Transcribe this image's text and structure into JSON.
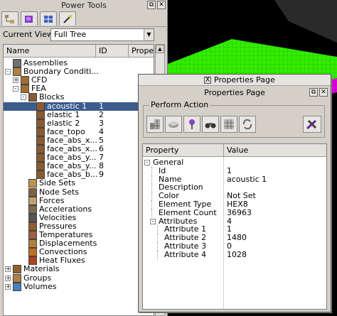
{
  "power_tools": {
    "title": "Power Tools",
    "current_view_label": "Current View",
    "current_view_value": "Full Tree",
    "columns": [
      "Name",
      "ID",
      "Proper"
    ],
    "tree": [
      {
        "label": "Assemblies",
        "id": "",
        "icon": "assemblies-icon",
        "depth": 0,
        "exp": ""
      },
      {
        "label": "Boundary Conditi...",
        "id": "",
        "icon": "boundary-conditions-icon",
        "depth": 0,
        "exp": "-"
      },
      {
        "label": "CFD",
        "id": "",
        "icon": "cfd-icon",
        "depth": 1,
        "exp": "+"
      },
      {
        "label": "FEA",
        "id": "",
        "icon": "fea-icon",
        "depth": 1,
        "exp": "-"
      },
      {
        "label": "Blocks",
        "id": "",
        "icon": "blocks-icon",
        "depth": 2,
        "exp": "-"
      },
      {
        "label": "acoustic 1",
        "id": "1",
        "icon": "block-icon",
        "depth": 3,
        "exp": "",
        "selected": true
      },
      {
        "label": "elastic 1",
        "id": "2",
        "icon": "block-icon",
        "depth": 3,
        "exp": ""
      },
      {
        "label": "elastic 2",
        "id": "3",
        "icon": "block-icon",
        "depth": 3,
        "exp": ""
      },
      {
        "label": "face_topo",
        "id": "4",
        "icon": "block-icon",
        "depth": 3,
        "exp": ""
      },
      {
        "label": "face_abs_x...",
        "id": "5",
        "icon": "block-icon",
        "depth": 3,
        "exp": ""
      },
      {
        "label": "face_abs_x...",
        "id": "6",
        "icon": "block-icon",
        "depth": 3,
        "exp": ""
      },
      {
        "label": "face_abs_y...",
        "id": "7",
        "icon": "block-icon",
        "depth": 3,
        "exp": ""
      },
      {
        "label": "face_abs_y...",
        "id": "8",
        "icon": "block-icon",
        "depth": 3,
        "exp": ""
      },
      {
        "label": "face_abs_b...",
        "id": "9",
        "icon": "block-icon",
        "depth": 3,
        "exp": ""
      },
      {
        "label": "Side Sets",
        "id": "",
        "icon": "side-sets-icon",
        "depth": 2,
        "exp": ""
      },
      {
        "label": "Node Sets",
        "id": "",
        "icon": "node-sets-icon",
        "depth": 2,
        "exp": ""
      },
      {
        "label": "Forces",
        "id": "",
        "icon": "forces-icon",
        "depth": 2,
        "exp": ""
      },
      {
        "label": "Accelerations",
        "id": "",
        "icon": "accelerations-icon",
        "depth": 2,
        "exp": ""
      },
      {
        "label": "Velocities",
        "id": "",
        "icon": "velocities-icon",
        "depth": 2,
        "exp": ""
      },
      {
        "label": "Pressures",
        "id": "",
        "icon": "pressures-icon",
        "depth": 2,
        "exp": ""
      },
      {
        "label": "Temperatures",
        "id": "",
        "icon": "temperatures-icon",
        "depth": 2,
        "exp": ""
      },
      {
        "label": "Displacements",
        "id": "",
        "icon": "displacements-icon",
        "depth": 2,
        "exp": ""
      },
      {
        "label": "Convections",
        "id": "",
        "icon": "convections-icon",
        "depth": 2,
        "exp": ""
      },
      {
        "label": "Heat Fluxes",
        "id": "",
        "icon": "heat-fluxes-icon",
        "depth": 2,
        "exp": ""
      },
      {
        "label": "Materials",
        "id": "",
        "icon": "materials-icon",
        "depth": 0,
        "exp": "+"
      },
      {
        "label": "Groups",
        "id": "",
        "icon": "groups-icon",
        "depth": 0,
        "exp": "+"
      },
      {
        "label": "Volumes",
        "id": "",
        "icon": "volumes-icon",
        "depth": 0,
        "exp": "+"
      }
    ]
  },
  "properties_window": {
    "window_title": "Properties Page",
    "title_icon": "X",
    "header": "Properties Page",
    "perform_action_label": "Perform Action",
    "columns": [
      "Property",
      "Value"
    ],
    "rows": [
      {
        "key": "General",
        "value": "",
        "depth": 0,
        "exp": "-"
      },
      {
        "key": "Id",
        "value": "1",
        "depth": 1,
        "exp": ""
      },
      {
        "key": "Name",
        "value": "acoustic 1",
        "depth": 1,
        "exp": ""
      },
      {
        "key": "Description",
        "value": "",
        "depth": 1,
        "exp": ""
      },
      {
        "key": "Color",
        "value": "Not Set",
        "depth": 1,
        "exp": ""
      },
      {
        "key": "Element Type",
        "value": "HEX8",
        "depth": 1,
        "exp": ""
      },
      {
        "key": "Element Count",
        "value": "36963",
        "depth": 1,
        "exp": ""
      },
      {
        "key": "Attributes",
        "value": "4",
        "depth": 1,
        "exp": "-"
      },
      {
        "key": "Attribute 1",
        "value": "1",
        "depth": 2,
        "exp": ""
      },
      {
        "key": "Attribute 2",
        "value": "1480",
        "depth": 2,
        "exp": ""
      },
      {
        "key": "Attribute 3",
        "value": "0",
        "depth": 2,
        "exp": ""
      },
      {
        "key": "Attribute 4",
        "value": "1028",
        "depth": 2,
        "exp": ""
      }
    ]
  },
  "colors": {
    "selection": "#3c5c8c",
    "mesh_green": "#33ee00",
    "mesh_magenta": "#dd00dd",
    "viewport_bg": "#000000"
  }
}
